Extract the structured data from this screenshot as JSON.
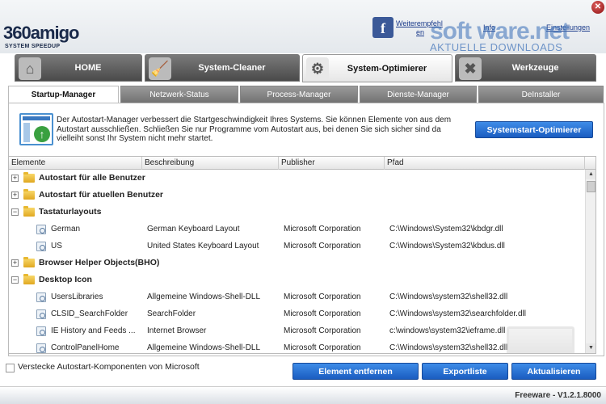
{
  "window": {
    "close_icon": "close-icon"
  },
  "logo": {
    "name": "360amigo",
    "tagline": "SYSTEM SPEEDUP"
  },
  "header_links": {
    "recommend_line1": "Weiterempfehl",
    "recommend_line2": "en",
    "info": "Info",
    "settings": "Einstellungen"
  },
  "watermark": {
    "title": "soft ware.net",
    "subtitle": "AKTUELLE DOWNLOADS"
  },
  "main_tabs": [
    {
      "label": "HOME",
      "icon": "home-icon"
    },
    {
      "label": "System-Cleaner",
      "icon": "broom-icon"
    },
    {
      "label": "System-Optimierer",
      "icon": "gear-icon"
    },
    {
      "label": "Werkzeuge",
      "icon": "tools-icon"
    }
  ],
  "sub_tabs": [
    "Startup-Manager",
    "Netzwerk-Status",
    "Process-Manager",
    "Dienste-Manager",
    "DeInstaller"
  ],
  "info": {
    "line1": "Der Autostart-Manager verbessert die Startgeschwindigkeit Ihres Systems. Sie können Elemente von aus dem",
    "line2": "Autostart ausschließen. Schließen Sie nur Programme vom Autostart aus, bei denen Sie sich sicher sind da",
    "line3": "vielleiht sonst Ihr System nicht mehr startet.",
    "button": "Systemstart-Optimierer"
  },
  "table": {
    "columns": [
      "Elemente",
      "Beschreibung",
      "Publisher",
      "Pfad"
    ],
    "rows": [
      {
        "type": "group",
        "expander": "+",
        "name": "Autostart für alle Benutzer"
      },
      {
        "type": "group",
        "expander": "+",
        "name": "Autostart für atuellen Benutzer"
      },
      {
        "type": "group",
        "expander": "−",
        "name": "Tastaturlayouts"
      },
      {
        "type": "item",
        "name": "German",
        "desc": "German Keyboard Layout",
        "publisher": "Microsoft Corporation",
        "path": "C:\\Windows\\System32\\kbdgr.dll"
      },
      {
        "type": "item",
        "name": "US",
        "desc": "United States Keyboard Layout",
        "publisher": "Microsoft Corporation",
        "path": "C:\\Windows\\System32\\kbdus.dll"
      },
      {
        "type": "group",
        "expander": "+",
        "name": "Browser Helper Objects(BHO)"
      },
      {
        "type": "group",
        "expander": "−",
        "name": "Desktop Icon"
      },
      {
        "type": "item",
        "name": "UsersLibraries",
        "desc": "Allgemeine Windows-Shell-DLL",
        "publisher": "Microsoft Corporation",
        "path": "C:\\Windows\\system32\\shell32.dll"
      },
      {
        "type": "item",
        "name": "CLSID_SearchFolder",
        "desc": "SearchFolder",
        "publisher": "Microsoft Corporation",
        "path": "C:\\Windows\\system32\\searchfolder.dll"
      },
      {
        "type": "item",
        "name": "IE History and Feeds ...",
        "desc": "Internet Browser",
        "publisher": "Microsoft Corporation",
        "path": "c:\\windows\\system32\\ieframe.dll"
      },
      {
        "type": "item",
        "name": "ControlPanelHome",
        "desc": "Allgemeine Windows-Shell-DLL",
        "publisher": "Microsoft Corporation",
        "path": "C:\\Windows\\system32\\shell32.dll"
      }
    ]
  },
  "footer": {
    "hide_ms_label": "Verstecke Autostart-Komponenten von Microsoft",
    "remove_button": "Element entfernen",
    "export_button": "Exportliste",
    "refresh_button": "Aktualisieren",
    "version": "Freeware - V1.2.1.8000"
  }
}
